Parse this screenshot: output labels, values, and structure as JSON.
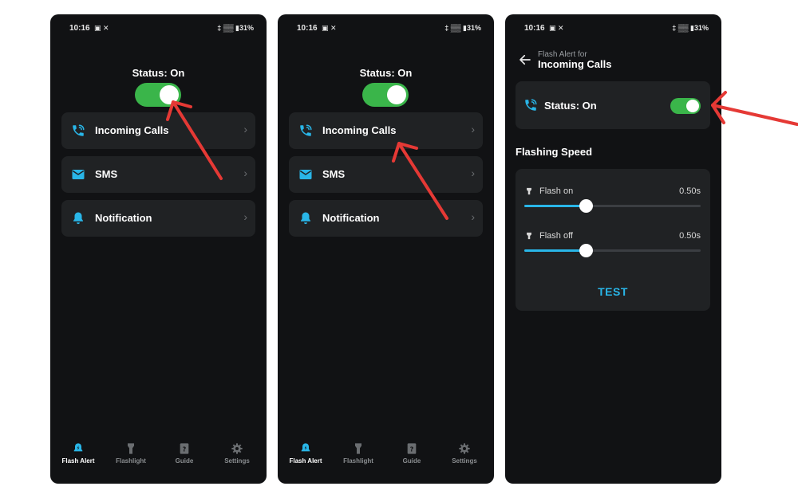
{
  "colors": {
    "accent": "#29b6e8",
    "toggle_on": "#3ab54a",
    "arrow": "#e53935",
    "card": "#202224",
    "background": "#111214"
  },
  "statusbar": {
    "time": "10:16",
    "notification_icons": "▣ ✕",
    "right": "‡ ▒▒ ▮31%"
  },
  "home": {
    "status_label": "Status: On",
    "status_enabled": true,
    "menu": [
      {
        "label": "Incoming Calls",
        "icon": "phone-ringing-icon"
      },
      {
        "label": "SMS",
        "icon": "envelope-icon"
      },
      {
        "label": "Notification",
        "icon": "bell-icon"
      }
    ],
    "chevron": "›"
  },
  "bottom_nav": [
    {
      "label": "Flash Alert",
      "icon": "flash-alert-icon",
      "active": true
    },
    {
      "label": "Flashlight",
      "icon": "flashlight-icon",
      "active": false
    },
    {
      "label": "Guide",
      "icon": "guide-icon",
      "active": false
    },
    {
      "label": "Settings",
      "icon": "gear-icon",
      "active": false
    }
  ],
  "detail": {
    "subtitle": "Flash Alert for",
    "title": "Incoming Calls",
    "status_label": "Status: On",
    "status_enabled": true,
    "section_heading": "Flashing Speed",
    "sliders": [
      {
        "label": "Flash on",
        "value": "0.50s",
        "fraction": 0.35
      },
      {
        "label": "Flash off",
        "value": "0.50s",
        "fraction": 0.35
      }
    ],
    "test_label": "TEST"
  }
}
